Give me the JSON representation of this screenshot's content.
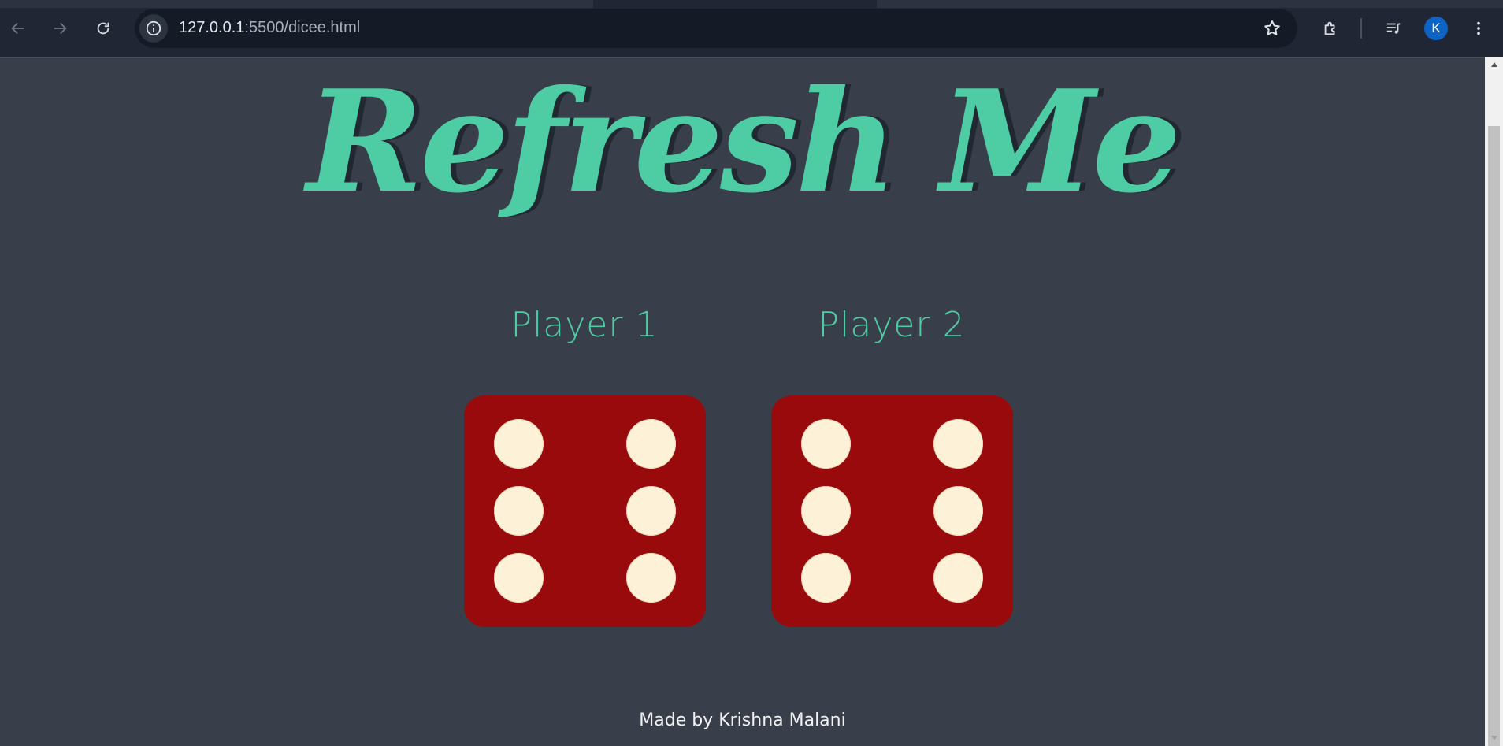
{
  "browser": {
    "url_host": "127.0.0.1",
    "url_rest": ":5500/dicee.html",
    "profile_initial": "K",
    "icons": {
      "back": "arrow-left-icon",
      "forward": "arrow-right-icon",
      "reload": "reload-icon",
      "site_info": "info-icon",
      "bookmark": "star-icon",
      "extensions": "puzzle-icon",
      "media": "playlist-icon",
      "menu": "kebab-menu-icon"
    }
  },
  "page": {
    "title": "Refresh Me",
    "players": [
      {
        "label": "Player 1",
        "die_value": 6
      },
      {
        "label": "Player 2",
        "die_value": 6
      }
    ],
    "footer": "Made by Krishna Malani"
  },
  "colors": {
    "background": "#393f4a",
    "accent": "#4ecca3",
    "title_shadow": "#222831",
    "die": "#980a0c",
    "pip": "#fdf1d8"
  }
}
